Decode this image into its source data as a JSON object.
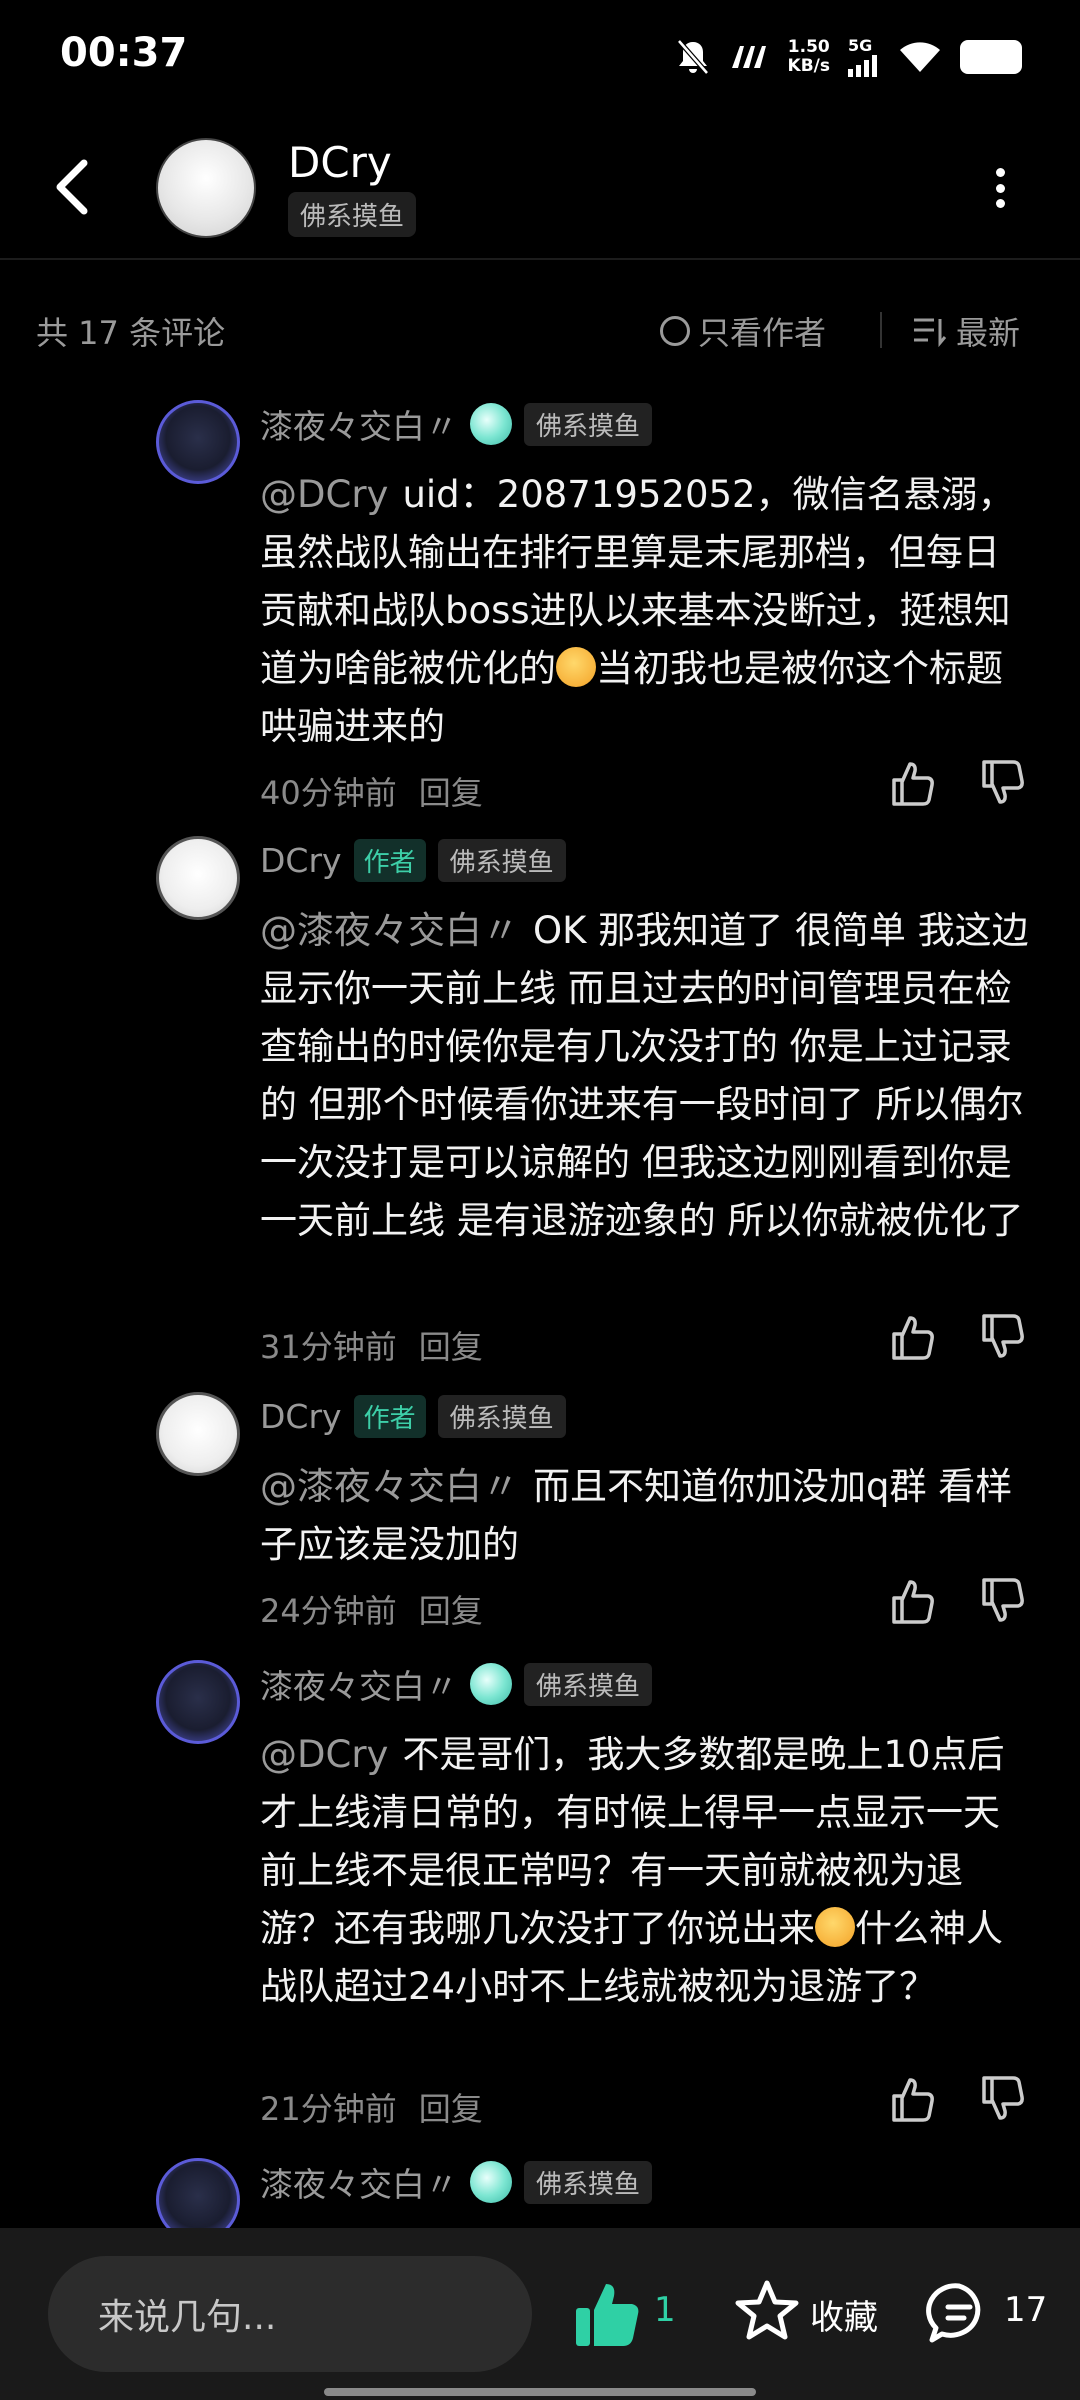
{
  "status_bar": {
    "time": "00:37",
    "net_speed_top": "1.50",
    "net_speed_bottom": "KB/s",
    "network": "5G"
  },
  "header": {
    "title": "DCry",
    "tag": "佛系摸鱼"
  },
  "comments_header": {
    "count_label": "共 17 条评论",
    "only_author": "只看作者",
    "sort": "最新"
  },
  "comments": [
    {
      "name": "漆夜々交白〃",
      "tag": "佛系摸鱼",
      "mention": "@DCry",
      "text_a": "uid：20871952052，微信名悬溺，虽然战队输出在排行里算是末尾那档，但每日贡献和战队boss进队以来基本没断过，挺想知道为啥能被优化的",
      "text_b": "当初我也是被你这个标题哄骗进来的",
      "time": "40分钟前",
      "reply": "回复"
    },
    {
      "name": "DCry",
      "author_tag": "作者",
      "tag": "佛系摸鱼",
      "mention": "@漆夜々交白〃",
      "text_a": "OK 那我知道了 很简单 我这边显示你一天前上线 而且过去的时间管理员在检查输出的时候你是有几次没打的 你是上过记录的 但那个时候看你进来有一段时间了 所以偶尔一次没打是可以谅解的 但我这边刚刚看到你是一天前上线 是有退游迹象的 所以你就被优化了",
      "time": "31分钟前",
      "reply": "回复"
    },
    {
      "name": "DCry",
      "author_tag": "作者",
      "tag": "佛系摸鱼",
      "mention": "@漆夜々交白〃",
      "text_a": "而且不知道你加没加q群 看样子应该是没加的",
      "time": "24分钟前",
      "reply": "回复"
    },
    {
      "name": "漆夜々交白〃",
      "tag": "佛系摸鱼",
      "mention": "@DCry",
      "text_a": "不是哥们，我大多数都是晚上10点后才上线清日常的，有时候上得早一点显示一天前上线不是很正常吗？有一天前就被视为退游？还有我哪几次没打了你说出来",
      "text_b": "什么神人战队超过24小时不上线就被视为退游了？",
      "time": "21分钟前",
      "reply": "回复"
    },
    {
      "name": "漆夜々交白〃",
      "tag": "佛系摸鱼"
    }
  ],
  "bottom_bar": {
    "input_placeholder": "来说几句...",
    "like_count": "1",
    "favorite_label": "收藏",
    "comment_count": "17"
  },
  "colors": {
    "accent": "#2fd0a5",
    "background": "#000000",
    "muted_text": "#9a9a9a"
  }
}
